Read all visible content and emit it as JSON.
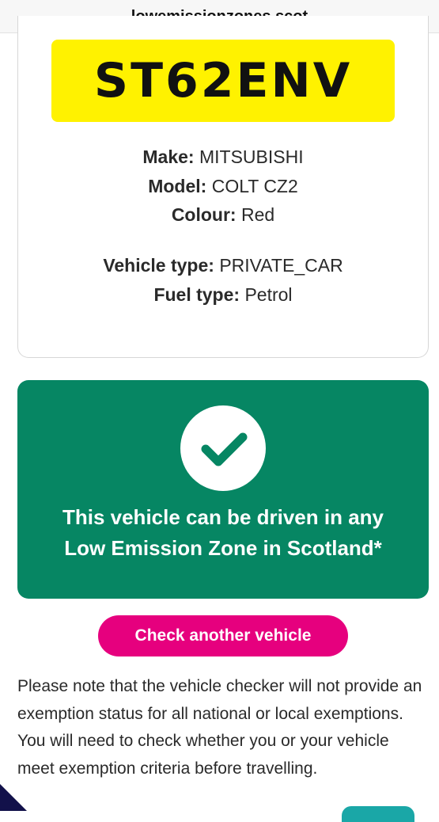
{
  "browser": {
    "url": "lowemissionzones.scot"
  },
  "vehicle": {
    "plate": "ST62ENV",
    "make_label": "Make:",
    "make": "MITSUBISHI",
    "model_label": "Model:",
    "model": "COLT CZ2",
    "colour_label": "Colour:",
    "colour": "Red",
    "type_label": "Vehicle type:",
    "type": "PRIVATE_CAR",
    "fuel_label": "Fuel type:",
    "fuel": "Petrol"
  },
  "result": {
    "icon": "check-icon",
    "line1": "This vehicle can be driven in any",
    "line2": "Low Emission Zone in Scotland*",
    "color": "#068663"
  },
  "actions": {
    "check_another": "Check another vehicle",
    "button_color": "#e6007e"
  },
  "note": {
    "text": "Please note that the vehicle checker will not provide an exemption status for all national or local exemptions. You will need to check whether you or your vehicle meet exemption criteria before travelling."
  },
  "plate_color": "#fff200"
}
